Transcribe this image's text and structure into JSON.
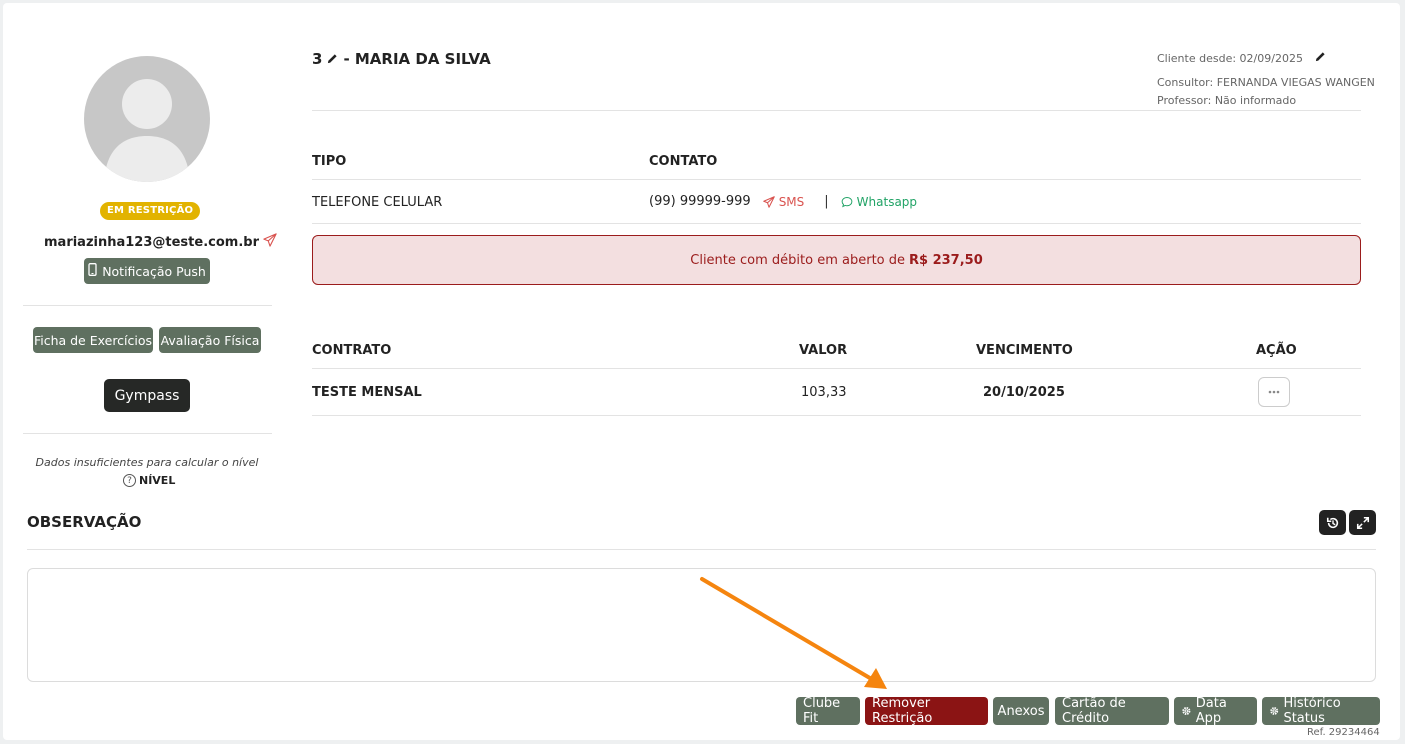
{
  "profile": {
    "status_badge": "EM RESTRIÇÃO",
    "email": "mariazinha123@teste.com.br",
    "push_label": "Notificação Push",
    "ficha_label": "Ficha de Exercícios",
    "avaliacao_label": "Avaliação Física",
    "gympass_label": "Gympass",
    "nivel_text": "Dados insuficientes para calcular o nível",
    "nivel_label": "NÍVEL"
  },
  "client": {
    "id": "3",
    "name": "- MARIA DA SILVA",
    "since": "Cliente desde: 02/09/2025",
    "consultor": "Consultor: FERNANDA VIEGAS WANGEN",
    "professor": "Professor: Não informado"
  },
  "contact": {
    "header_tipo": "TIPO",
    "header_contato": "CONTATO",
    "tipo": "TELEFONE CELULAR",
    "phone": "(99) 99999-999",
    "sms_label": "SMS",
    "separator": "|",
    "whatsapp_label": "Whatsapp"
  },
  "debt": {
    "text": "Cliente com débito em aberto de",
    "amount": "R$ 237,50"
  },
  "contracts": {
    "headers": [
      "CONTRATO",
      "VALOR",
      "VENCIMENTO",
      "AÇÃO"
    ],
    "rows": [
      {
        "contrato": "TESTE MENSAL",
        "valor": "103,33",
        "vencimento": "20/10/2025"
      }
    ]
  },
  "observacao": {
    "title": "OBSERVAÇÃO",
    "value": ""
  },
  "actions": {
    "clube_fit": "Clube Fit",
    "remover_restricao": "Remover Restrição",
    "anexos": "Anexos",
    "cartao_credito": "Cartão de Crédito",
    "data_app": "Data App",
    "historico_status": "Histórico Status"
  },
  "ref": "Ref. 29234464",
  "colors": {
    "accent_green": "#5f7060",
    "danger_red": "#8b1414",
    "warning_yellow": "#e2b300",
    "whatsapp_green": "#21a366",
    "sms_red": "#d9534f",
    "annotation_arrow": "#f5850f"
  }
}
